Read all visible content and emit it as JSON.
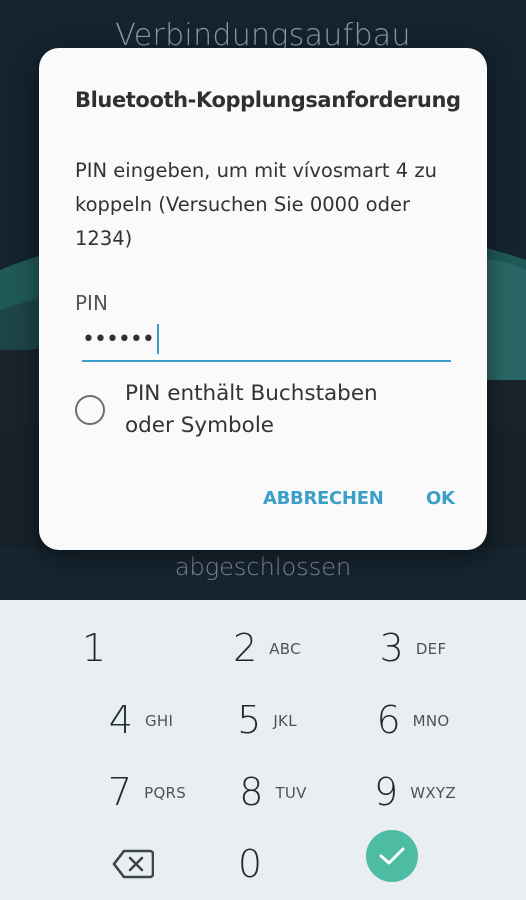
{
  "background": {
    "title": "Verbindungsaufbau",
    "status": "abgeschlossen"
  },
  "dialog": {
    "title": "Bluetooth-Kopplungsanforderung",
    "message": "PIN eingeben, um mit vívosmart 4 zu koppeln (Versuchen Sie 0000 oder 1234)",
    "pin_label": "PIN",
    "pin_value": "••••••",
    "checkbox_label": "PIN enthält Buchstaben oder Symbole",
    "checkbox_checked": false,
    "cancel_label": "ABBRECHEN",
    "ok_label": "OK"
  },
  "keypad": {
    "keys": [
      {
        "digit": "1",
        "letters": ""
      },
      {
        "digit": "2",
        "letters": "ABC"
      },
      {
        "digit": "3",
        "letters": "DEF"
      },
      {
        "digit": "4",
        "letters": "GHI"
      },
      {
        "digit": "5",
        "letters": "JKL"
      },
      {
        "digit": "6",
        "letters": "MNO"
      },
      {
        "digit": "7",
        "letters": "PQRS"
      },
      {
        "digit": "8",
        "letters": "TUV"
      },
      {
        "digit": "9",
        "letters": "WXYZ"
      },
      {
        "digit": "0",
        "letters": ""
      }
    ],
    "backspace_icon": "backspace-icon",
    "done_icon": "checkmark-icon"
  },
  "colors": {
    "accent": "#3a9fc9",
    "done_button": "#4dbca3",
    "keypad_bg": "#e9eef1"
  }
}
